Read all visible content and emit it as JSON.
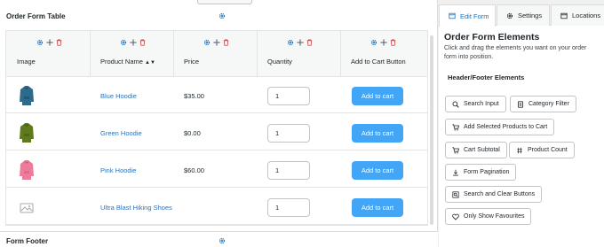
{
  "section": {
    "title": "Order Form Table",
    "footer_title": "Form Footer"
  },
  "columns": [
    {
      "label": "Image"
    },
    {
      "label": "Product Name",
      "sort_icon": "▲▼"
    },
    {
      "label": "Price"
    },
    {
      "label": "Quantity"
    },
    {
      "label": "Add to Cart Button"
    }
  ],
  "rows": [
    {
      "name": "Blue Hoodie",
      "price": "$35.00",
      "qty": "1",
      "cart": "Add to cart",
      "thumb": "hoodie-blue"
    },
    {
      "name": "Green Hoodie",
      "price": "$0.00",
      "qty": "1",
      "cart": "Add to cart",
      "thumb": "hoodie-green"
    },
    {
      "name": "Pink Hoodie",
      "price": "$60.00",
      "qty": "1",
      "cart": "Add to cart",
      "thumb": "hoodie-pink"
    },
    {
      "name": "Ultra Blast Hiking Shoes",
      "price": "",
      "qty": "1",
      "cart": "Add to cart",
      "thumb": "image-placeholder"
    }
  ],
  "panel": {
    "tabs": [
      {
        "label": "Edit Form",
        "icon": "edit-icon"
      },
      {
        "label": "Settings",
        "icon": "gear-icon"
      },
      {
        "label": "Locations",
        "icon": "browser-icon"
      }
    ],
    "title": "Order Form Elements",
    "description": "Click and drag the elements you want on your order form into position.",
    "subheading": "Header/Footer Elements",
    "elements": [
      {
        "label": "Search Input",
        "icon": "search-icon"
      },
      {
        "label": "Category Filter",
        "icon": "list-icon"
      },
      {
        "label": "Add Selected Products to Cart",
        "icon": "cart-icon"
      },
      {
        "label": "Cart Subtotal",
        "icon": "cart-icon"
      },
      {
        "label": "Product Count",
        "icon": "hash-icon"
      },
      {
        "label": "Form Pagination",
        "icon": "download-icon"
      },
      {
        "label": "Search and Clear Buttons",
        "icon": "search-clear-icon"
      },
      {
        "label": "Only Show Favourites",
        "icon": "heart-icon"
      }
    ]
  },
  "colors": {
    "accent": "#2271b1",
    "button": "#42a5f5",
    "link": "#2f71b3",
    "delete": "#d63638"
  }
}
